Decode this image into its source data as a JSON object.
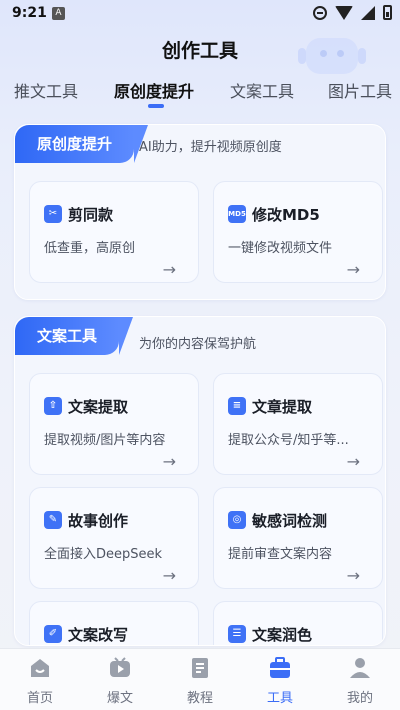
{
  "status_bar": {
    "time": "9:21",
    "notif_letter": "A"
  },
  "header": {
    "title": "创作工具"
  },
  "tabs": [
    {
      "label": "推文工具",
      "active": false
    },
    {
      "label": "原创度提升",
      "active": true
    },
    {
      "label": "文案工具",
      "active": false
    },
    {
      "label": "图片工具",
      "active": false
    }
  ],
  "sections": [
    {
      "badge": "原创度提升",
      "subtitle": "AI助力，提升视频原创度",
      "tools": [
        {
          "icon": "scissors-icon",
          "name": "剪同款",
          "desc": "低查重，高原创"
        },
        {
          "icon": "md5-icon",
          "icon_text": "MD5",
          "name": "修改MD5",
          "desc": "一键修改视频文件"
        }
      ]
    },
    {
      "badge": "文案工具",
      "subtitle": "为你的内容保驾护航",
      "tools": [
        {
          "icon": "extract-icon",
          "name": "文案提取",
          "desc": "提取视频/图片等内容"
        },
        {
          "icon": "article-icon",
          "name": "文章提取",
          "desc": "提取公众号/知乎等..."
        },
        {
          "icon": "edit-icon",
          "name": "故事创作",
          "desc": "全面接入DeepSeek"
        },
        {
          "icon": "shield-check-icon",
          "name": "敏感词检测",
          "desc": "提前审查文案内容"
        },
        {
          "icon": "pen-icon",
          "name": "文案改写",
          "desc": ""
        },
        {
          "icon": "polish-icon",
          "name": "文案润色",
          "desc": ""
        }
      ]
    }
  ],
  "bottom_nav": [
    {
      "label": "首页",
      "icon": "home-icon",
      "active": false
    },
    {
      "label": "爆文",
      "icon": "video-icon",
      "active": false
    },
    {
      "label": "教程",
      "icon": "book-icon",
      "active": false
    },
    {
      "label": "工具",
      "icon": "toolbox-icon",
      "active": true
    },
    {
      "label": "我的",
      "icon": "user-icon",
      "active": false
    }
  ],
  "colors": {
    "accent": "#3b6df6",
    "badge_start": "#2f68f5",
    "badge_end": "#5d8bff"
  },
  "arrow_glyph": "→"
}
